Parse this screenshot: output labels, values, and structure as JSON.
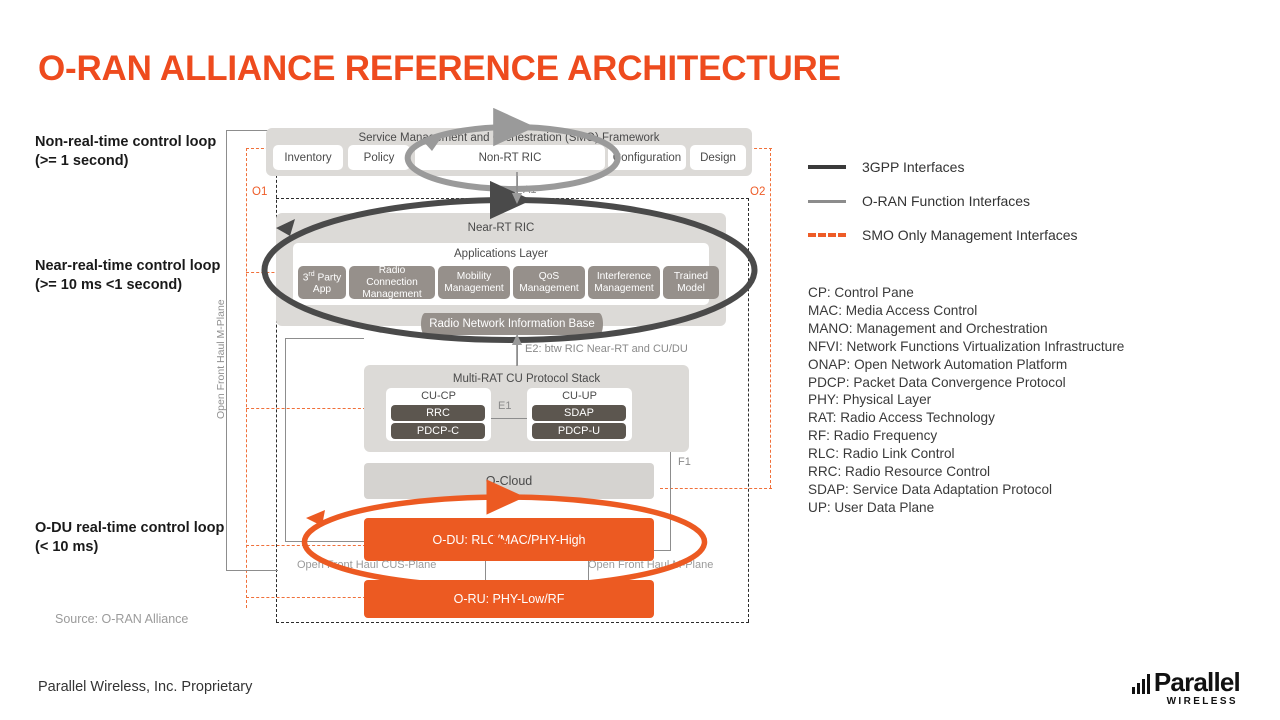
{
  "title": "O-RAN ALLIANCE REFERENCE ARCHITECTURE",
  "colors": {
    "accent_orange": "#EE4B1E",
    "box_orange": "#EC5A22",
    "dashed_orange": "#F0703A",
    "app_gray": "#96908B",
    "protocol_gray": "#5C564F",
    "panel_gray": "#DCDAD7",
    "legend_3gpp": "#3a3a3a",
    "legend_oran": "#8c8c8c"
  },
  "control_loops": [
    {
      "line1": "Non-real-time control loop",
      "line2": "(>= 1 second)"
    },
    {
      "line1": "Near-real-time control loop",
      "line2": "(>= 10 ms  <1 second)"
    },
    {
      "line1": "O-DU real-time control loop",
      "line2": "(< 10 ms)"
    }
  ],
  "source_note": "Source: O-RAN Alliance",
  "footer_note": "Parallel Wireless, Inc. Proprietary",
  "smo": {
    "title": "Service Management and Orchestration (SMO) Framework",
    "items": [
      {
        "label": "Inventory"
      },
      {
        "label": "Policy"
      },
      {
        "label": "Non-RT RIC"
      },
      {
        "label": "Configuration"
      },
      {
        "label": "Design"
      }
    ]
  },
  "near_rt_ric": {
    "title": "Near-RT RIC",
    "apps_layer_title": "Applications Layer",
    "apps": [
      {
        "line1": "3rd Party",
        "line2": "App",
        "sup": true
      },
      {
        "line1": "Radio Connection",
        "line2": "Management"
      },
      {
        "line1": "Mobility",
        "line2": "Management"
      },
      {
        "line1": "QoS",
        "line2": "Management"
      },
      {
        "line1": "Interference",
        "line2": "Management"
      },
      {
        "line1": "Trained",
        "line2": "Model"
      }
    ],
    "rnib": "Radio Network Information Base"
  },
  "cu_stack": {
    "title": "Multi-RAT CU Protocol Stack",
    "cu_cp": {
      "title": "CU-CP",
      "layers": [
        "RRC",
        "PDCP-C"
      ]
    },
    "cu_up": {
      "title": "CU-UP",
      "layers": [
        "SDAP",
        "PDCP-U"
      ]
    },
    "e1_label": "E1"
  },
  "o_cloud": "O-Cloud",
  "o_du": "O-DU: RLC/MAC/PHY-High",
  "o_ru": "O-RU: PHY-Low/RF",
  "interfaces": {
    "o1": "O1",
    "o2": "O2",
    "a1": "A1",
    "e2": "E2: btw RIC Near-RT and CU/DU",
    "f1": "F1",
    "fronthaul_mplane_vertical": "Open Front Haul M-Plane",
    "fronthaul_cus_plane": "Open Front Haul CUS-Plane",
    "fronthaul_mplane": "Open Front Haul M-Plane"
  },
  "legend": [
    {
      "label": "3GPP Interfaces",
      "style": "solid-dark",
      "color": "#3a3a3a"
    },
    {
      "label": "O-RAN Function Interfaces",
      "style": "solid-gray",
      "color": "#8c8c8c"
    },
    {
      "label": "SMO Only Management Interfaces",
      "style": "dashed-orange",
      "color": "#EE5C28"
    }
  ],
  "acronyms": [
    "CP: Control Pane",
    "MAC: Media Access Control",
    "MANO: Management and Orchestration",
    "NFVI: Network Functions Virtualization Infrastructure",
    "ONAP: Open Network Automation Platform",
    "PDCP: Packet Data Convergence Protocol",
    "PHY: Physical Layer",
    "RAT: Radio Access Technology",
    "RF: Radio Frequency",
    "RLC: Radio Link Control",
    "RRC: Radio Resource Control",
    "SDAP: Service Data Adaptation Protocol",
    "UP: User Data Plane"
  ],
  "logo": {
    "name": "Parallel",
    "sub": "WIRELESS"
  }
}
